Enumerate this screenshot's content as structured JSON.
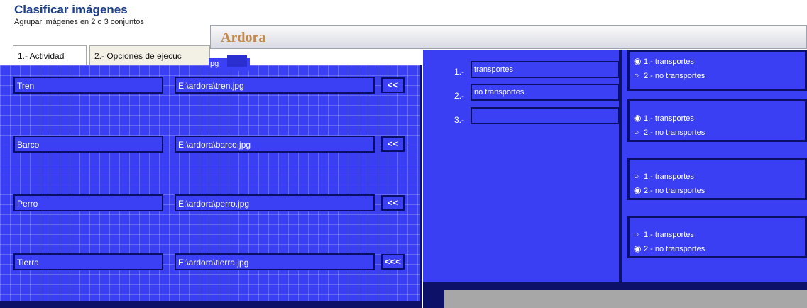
{
  "app": {
    "title": "Clasificar imágenes",
    "subtitle": "Agrupar imágenes en 2 o 3 conjuntos"
  },
  "tabs": [
    {
      "label": "1.- Actividad"
    },
    {
      "label": "2.- Opciones de ejecuc"
    }
  ],
  "overlay": {
    "title": "Ardora",
    "fragment": "pg"
  },
  "images": [
    {
      "name": "Tren",
      "path": "E:\\ardora\\tren.jpg",
      "button": "<<"
    },
    {
      "name": "Barco",
      "path": "E:\\ardora\\barco.jpg",
      "button": "<<"
    },
    {
      "name": "Perro",
      "path": "E:\\ardora\\perro.jpg",
      "button": "<<"
    },
    {
      "name": "Tierra",
      "path": "E:\\ardora\\tierra.jpg",
      "button": "<<<"
    }
  ],
  "sets": [
    {
      "label": "1.-",
      "value": "transportes"
    },
    {
      "label": "2.-",
      "value": "no transportes"
    },
    {
      "label": "3.-",
      "value": ""
    }
  ],
  "groups": [
    {
      "options": [
        "1.- transportes",
        "2.- no transportes"
      ],
      "selected": 0
    },
    {
      "options": [
        "1.- transportes",
        "2.- no transportes"
      ],
      "selected": 0
    },
    {
      "options": [
        "1.- transportes",
        "2.- no transportes"
      ],
      "selected": 1
    },
    {
      "options": [
        "1.- transportes",
        "2.- no transportes"
      ],
      "selected": 1
    }
  ],
  "colors": {
    "panel_blue": "#3a3ff3",
    "dark_navy": "#0d1268",
    "title_blue": "#1c3d8a",
    "ardora_orange": "#c58a4a"
  }
}
